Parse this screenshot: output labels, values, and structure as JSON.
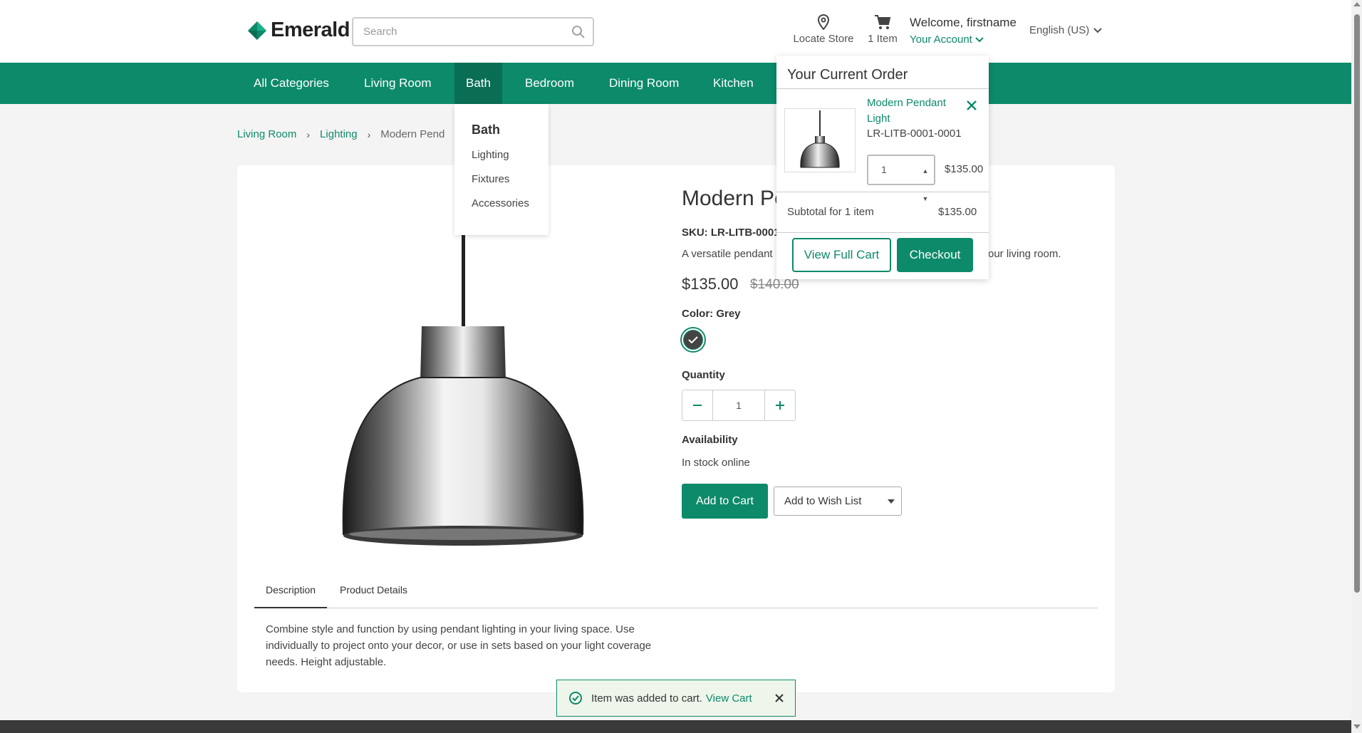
{
  "header": {
    "logo_text": "Emerald",
    "search_placeholder": "Search",
    "locate_label": "Locate Store",
    "cart_label": "1 Item",
    "welcome": "Welcome, firstname",
    "account_label": "Your Account",
    "language": "English (US)"
  },
  "nav": {
    "items": [
      "All Categories",
      "Living Room",
      "Bath",
      "Bedroom",
      "Dining Room",
      "Kitchen"
    ],
    "active": "Bath"
  },
  "bath_menu": {
    "title": "Bath",
    "links": [
      "Lighting",
      "Fixtures",
      "Accessories"
    ]
  },
  "breadcrumb": {
    "items": [
      "Living Room",
      "Lighting",
      "Modern Pendant Light"
    ],
    "visible_current": "Modern Pend"
  },
  "product": {
    "title": "Modern Pe",
    "sku": "SKU: LR-LITB-0001",
    "desc_left": "A versatile pendant",
    "desc_right": "our living room.",
    "price": "$135.00",
    "old_price": "$140.00",
    "color_label": "Color: Grey",
    "quantity_label": "Quantity",
    "quantity": "1",
    "availability_label": "Availability",
    "availability": "In stock online",
    "add_to_cart": "Add to Cart",
    "add_to_wishlist": "Add to Wish List",
    "tabs": [
      "Description",
      "Product Details"
    ],
    "active_tab": "Description",
    "description": "Combine style and function by using pendant lighting in your living space. Use individually to project onto your decor, or use in sets based on your light coverage needs. Height adjustable."
  },
  "cart_popup": {
    "title": "Your Current Order",
    "item_name": "Modern Pendant Light",
    "item_sku": "LR-LITB-0001-0001",
    "item_qty": "1",
    "item_price": "$135.00",
    "subtotal_label": "Subtotal for 1 item",
    "subtotal_value": "$135.00",
    "view_cart": "View Full Cart",
    "checkout": "Checkout"
  },
  "toast": {
    "message": "Item was added to cart.",
    "link": "View Cart"
  },
  "colors": {
    "brand": "#0d8a6a",
    "brand_dark": "#0a6e55"
  },
  "icons": [
    "diamond-logo-icon",
    "search-icon",
    "location-pin-icon",
    "cart-icon",
    "chevron-down-icon",
    "chevron-right-icon",
    "check-icon",
    "minus-icon",
    "plus-icon",
    "close-icon",
    "check-circle-icon",
    "caret-down-icon"
  ]
}
